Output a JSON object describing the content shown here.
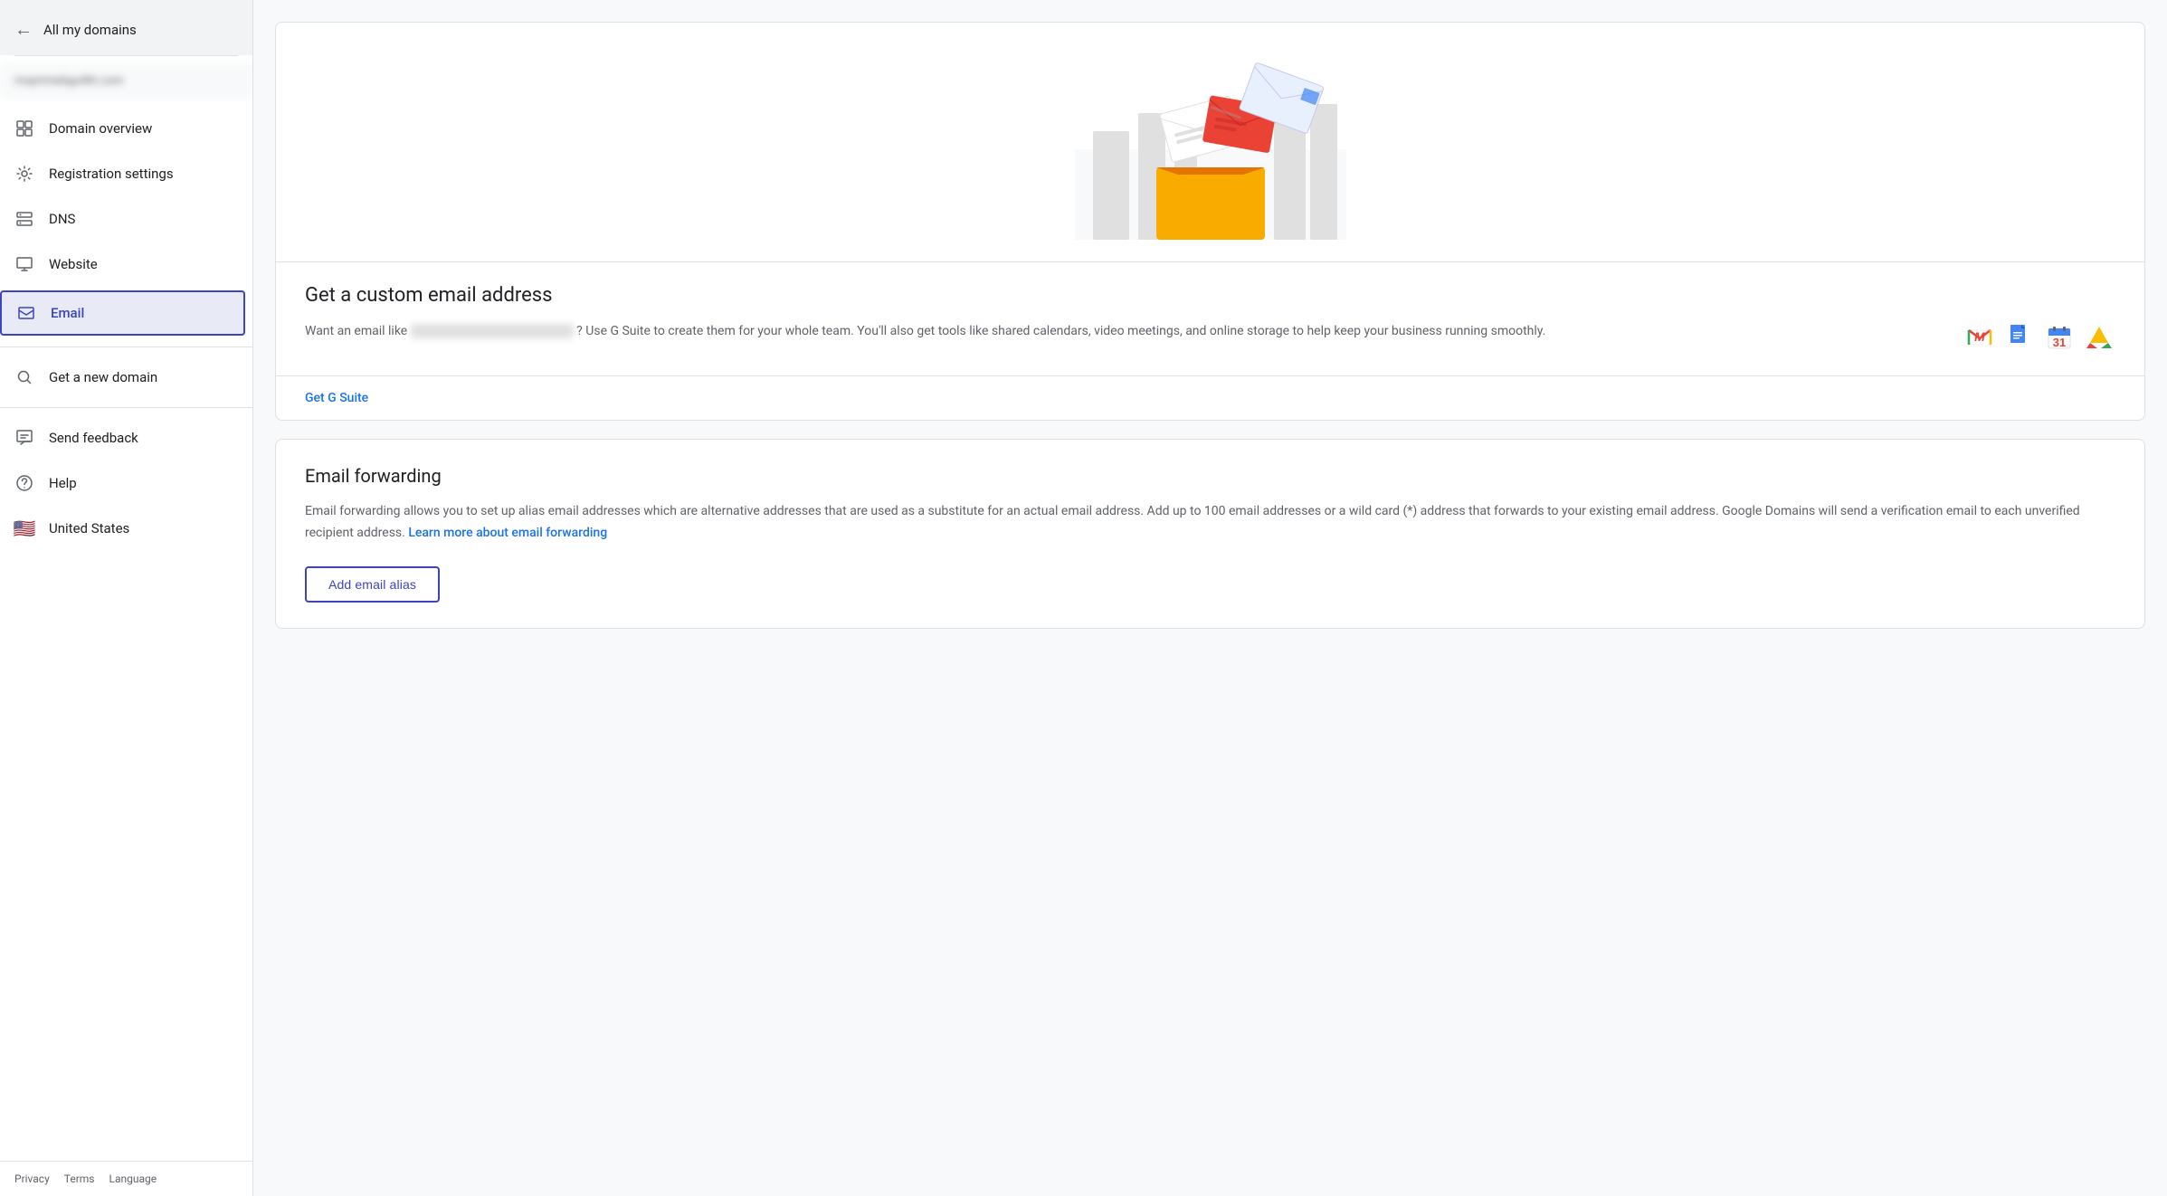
{
  "sidebar": {
    "back_label": "All my domains",
    "domain_blurred": "mxprime6gu4th.com",
    "nav_items": [
      {
        "id": "domain-overview",
        "label": "Domain overview",
        "icon": "grid"
      },
      {
        "id": "registration-settings",
        "label": "Registration settings",
        "icon": "gear"
      },
      {
        "id": "dns",
        "label": "DNS",
        "icon": "server"
      },
      {
        "id": "website",
        "label": "Website",
        "icon": "monitor"
      },
      {
        "id": "email",
        "label": "Email",
        "icon": "email",
        "active": true
      }
    ],
    "secondary_items": [
      {
        "id": "get-new-domain",
        "label": "Get a new domain",
        "icon": "search"
      }
    ],
    "utility_items": [
      {
        "id": "send-feedback",
        "label": "Send feedback",
        "icon": "feedback"
      },
      {
        "id": "help",
        "label": "Help",
        "icon": "help"
      },
      {
        "id": "united-states",
        "label": "United States",
        "icon": "flag"
      }
    ],
    "footer_links": [
      "Privacy",
      "Terms",
      "Language"
    ]
  },
  "main": {
    "custom_email": {
      "title": "Get a custom email address",
      "description_before": "Want an email like",
      "description_after": "? Use G Suite to create them for your whole team. You'll also get tools like shared calendars, video meetings, and online storage to help keep your business running smoothly.",
      "get_gsuite_label": "Get G Suite"
    },
    "email_forwarding": {
      "title": "Email forwarding",
      "description": "Email forwarding allows you to set up alias email addresses which are alternative addresses that are used as a substitute for an actual email address. Add up to 100 email addresses or a wild card (*) address that forwards to your existing email address. Google Domains will send a verification email to each unverified recipient address.",
      "learn_more_label": "Learn more about email forwarding",
      "add_alias_label": "Add email alias"
    }
  }
}
